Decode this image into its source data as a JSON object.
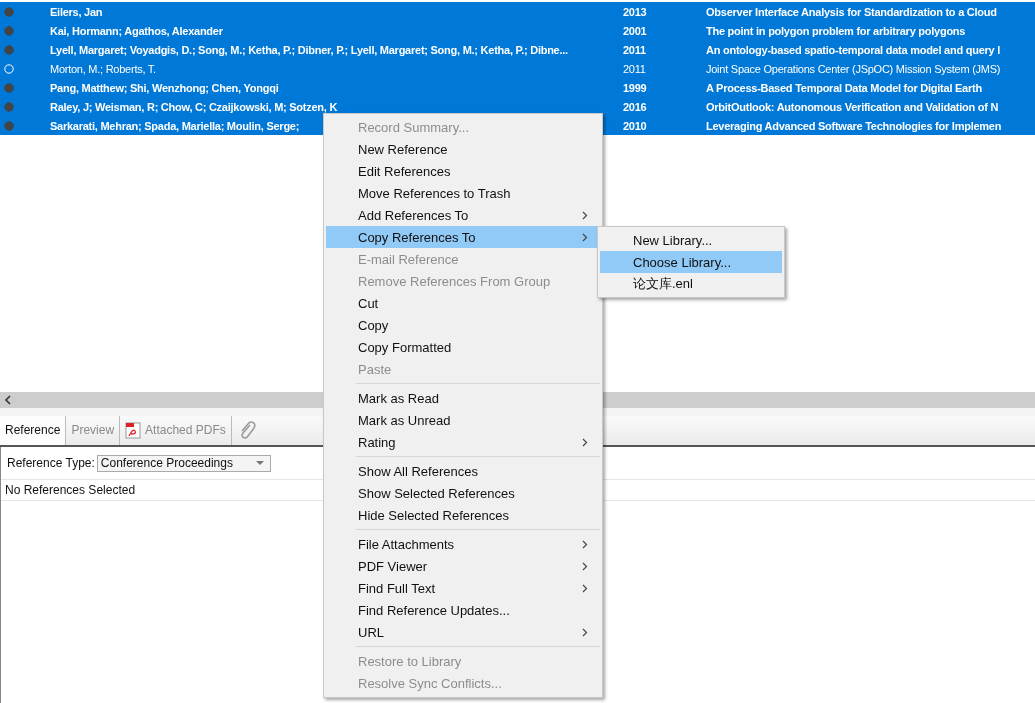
{
  "rows": [
    {
      "read": false,
      "selected": true,
      "authors": "Eilers, Jan",
      "year": "2013",
      "title": "Observer Interface Analysis for Standardization to a Cloud"
    },
    {
      "read": false,
      "selected": true,
      "authors": "Kai, Hormann; Agathos, Alexander",
      "year": "2001",
      "title": "The point in polygon problem for arbitrary polygons"
    },
    {
      "read": false,
      "selected": true,
      "authors": "Lyell, Margaret; Voyadgis, D.; Song, M.; Ketha, P.; Dibner, P.; Lyell, Margaret; Song, M.; Ketha, P.; Dibne...",
      "year": "2011",
      "title": "An ontology-based spatio-temporal data model and query l"
    },
    {
      "read": true,
      "selected": true,
      "authors": "Morton, M.; Roberts, T.",
      "year": "2011",
      "title": "Joint Space Operations Center (JSpOC) Mission System (JMS)"
    },
    {
      "read": false,
      "selected": true,
      "authors": "Pang, Matthew; Shi, Wenzhong; Chen, Yongqi",
      "year": "1999",
      "title": "A Process-Based Temporal Data Model for Digital Earth"
    },
    {
      "read": false,
      "selected": true,
      "authors": "Raley, J; Weisman, R; Chow, C; Czaijkowski, M; Sotzen, K",
      "year": "2016",
      "title": "OrbitOutlook: Autonomous Verification and Validation of N"
    },
    {
      "read": false,
      "selected": true,
      "authors": "Sarkarati, Mehran; Spada, Mariella; Moulin, Serge;",
      "year": "2010",
      "title": "Leveraging Advanced Software Technologies for Implemen"
    }
  ],
  "tabs": [
    {
      "kind": "text",
      "label": "Reference",
      "selected": true
    },
    {
      "kind": "text",
      "label": "Preview",
      "selected": false
    },
    {
      "kind": "pdf",
      "label": "Attached PDFs",
      "selected": false
    },
    {
      "kind": "clip",
      "selected": false
    }
  ],
  "reference_type": {
    "label": "Reference Type:",
    "value": "Conference Proceedings"
  },
  "status": "No References Selected",
  "context_menu": {
    "items": [
      {
        "kind": "item",
        "label": "Record Summary...",
        "disabled": true,
        "submenu": false,
        "selected": false
      },
      {
        "kind": "item",
        "label": "New Reference",
        "disabled": false,
        "submenu": false,
        "selected": false
      },
      {
        "kind": "item",
        "label": "Edit References",
        "disabled": false,
        "submenu": false,
        "selected": false
      },
      {
        "kind": "item",
        "label": "Move References to Trash",
        "disabled": false,
        "submenu": false,
        "selected": false
      },
      {
        "kind": "item",
        "label": "Add References To",
        "disabled": false,
        "submenu": true,
        "selected": false
      },
      {
        "kind": "item",
        "label": "Copy References To",
        "disabled": false,
        "submenu": true,
        "selected": true
      },
      {
        "kind": "item",
        "label": "E-mail Reference",
        "disabled": true,
        "submenu": false,
        "selected": false
      },
      {
        "kind": "item",
        "label": "Remove References From Group",
        "disabled": true,
        "submenu": false,
        "selected": false
      },
      {
        "kind": "item",
        "label": "Cut",
        "disabled": false,
        "submenu": false,
        "selected": false
      },
      {
        "kind": "item",
        "label": "Copy",
        "disabled": false,
        "submenu": false,
        "selected": false
      },
      {
        "kind": "item",
        "label": "Copy Formatted",
        "disabled": false,
        "submenu": false,
        "selected": false
      },
      {
        "kind": "item",
        "label": "Paste",
        "disabled": true,
        "submenu": false,
        "selected": false
      },
      {
        "kind": "separator"
      },
      {
        "kind": "item",
        "label": "Mark as Read",
        "disabled": false,
        "submenu": false,
        "selected": false
      },
      {
        "kind": "item",
        "label": "Mark as Unread",
        "disabled": false,
        "submenu": false,
        "selected": false
      },
      {
        "kind": "item",
        "label": "Rating",
        "disabled": false,
        "submenu": true,
        "selected": false
      },
      {
        "kind": "separator"
      },
      {
        "kind": "item",
        "label": "Show All References",
        "disabled": false,
        "submenu": false,
        "selected": false
      },
      {
        "kind": "item",
        "label": "Show Selected References",
        "disabled": false,
        "submenu": false,
        "selected": false
      },
      {
        "kind": "item",
        "label": "Hide Selected References",
        "disabled": false,
        "submenu": false,
        "selected": false
      },
      {
        "kind": "separator"
      },
      {
        "kind": "item",
        "label": "File Attachments",
        "disabled": false,
        "submenu": true,
        "selected": false
      },
      {
        "kind": "item",
        "label": "PDF Viewer",
        "disabled": false,
        "submenu": true,
        "selected": false
      },
      {
        "kind": "item",
        "label": "Find Full Text",
        "disabled": false,
        "submenu": true,
        "selected": false
      },
      {
        "kind": "item",
        "label": "Find Reference Updates...",
        "disabled": false,
        "submenu": false,
        "selected": false
      },
      {
        "kind": "item",
        "label": "URL",
        "disabled": false,
        "submenu": true,
        "selected": false
      },
      {
        "kind": "separator"
      },
      {
        "kind": "item",
        "label": "Restore to Library",
        "disabled": true,
        "submenu": false,
        "selected": false
      },
      {
        "kind": "item",
        "label": "Resolve Sync Conflicts...",
        "disabled": true,
        "submenu": false,
        "selected": false
      }
    ]
  },
  "submenu": {
    "items": [
      {
        "label": "New Library...",
        "selected": false
      },
      {
        "label": "Choose Library...",
        "selected": true
      },
      {
        "label": "论文库.enl",
        "selected": false
      }
    ]
  }
}
